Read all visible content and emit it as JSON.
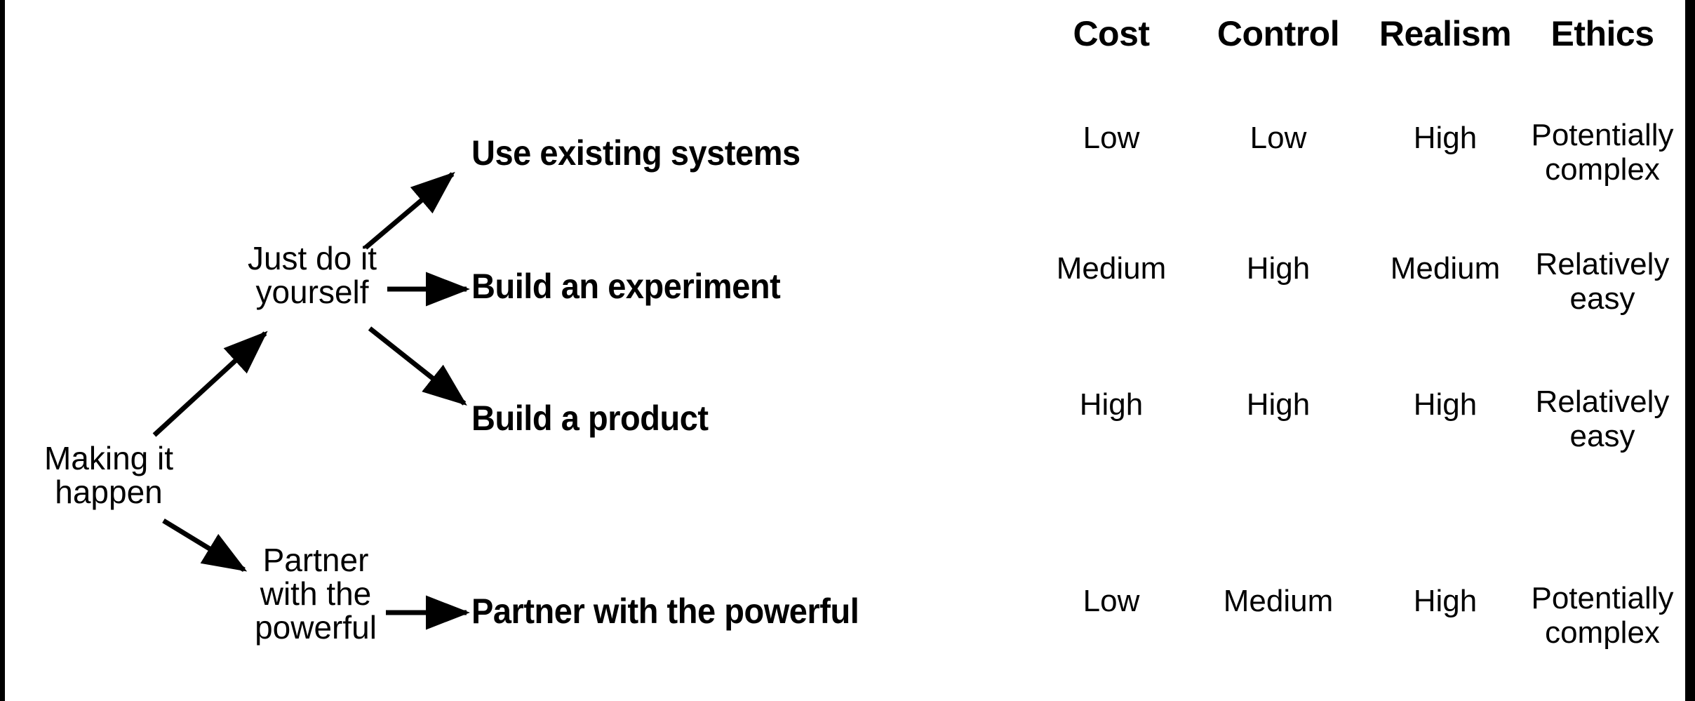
{
  "diagram": {
    "type": "tree-with-comparison-table",
    "root": {
      "label": "Making it\nhappen"
    },
    "branches": [
      {
        "label": "Just do it\nyourself"
      },
      {
        "label": "Partner\nwith the\npowerful"
      }
    ],
    "leaves": [
      {
        "label": "Use existing systems"
      },
      {
        "label": "Build an experiment"
      },
      {
        "label": "Build a product"
      },
      {
        "label": "Partner with the powerful"
      }
    ]
  },
  "table": {
    "columns": [
      "Cost",
      "Control",
      "Realism",
      "Ethics"
    ],
    "rows": [
      {
        "option": "Use existing systems",
        "cells": [
          "Low",
          "Low",
          "High",
          "Potentially\ncomplex"
        ]
      },
      {
        "option": "Build an experiment",
        "cells": [
          "Medium",
          "High",
          "Medium",
          "Relatively\neasy"
        ]
      },
      {
        "option": "Build a product",
        "cells": [
          "High",
          "High",
          "High",
          "Relatively\neasy"
        ]
      },
      {
        "option": "Partner with the powerful",
        "cells": [
          "Low",
          "Medium",
          "High",
          "Potentially\ncomplex"
        ]
      }
    ]
  },
  "style": {
    "background": "#ffffff",
    "ink": "#000000"
  }
}
